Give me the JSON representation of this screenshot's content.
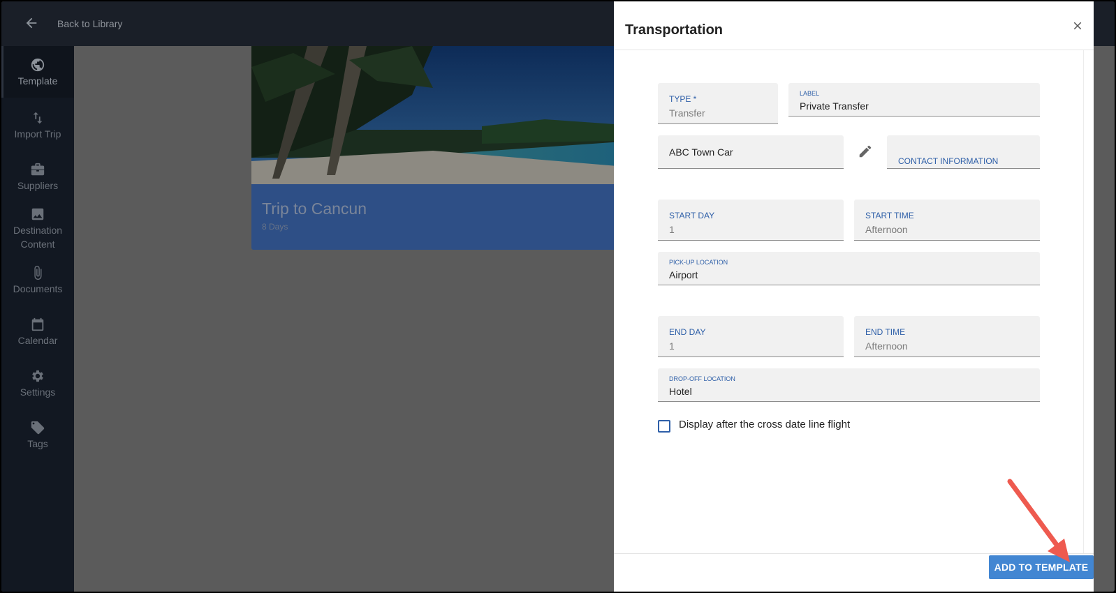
{
  "topbar": {
    "back_label": "Back to Library"
  },
  "sidebar": {
    "items": [
      {
        "label": "Template",
        "icon": "globe-icon"
      },
      {
        "label": "Import Trip",
        "icon": "swap-vertical-icon"
      },
      {
        "label": "Suppliers",
        "icon": "briefcase-icon"
      },
      {
        "label": "Destination Content",
        "icon": "image-icon"
      },
      {
        "label": "Documents",
        "icon": "paperclip-icon"
      },
      {
        "label": "Calendar",
        "icon": "calendar-icon"
      },
      {
        "label": "Settings",
        "icon": "gear-icon"
      },
      {
        "label": "Tags",
        "icon": "tag-icon"
      }
    ]
  },
  "card": {
    "title": "Trip to Cancun",
    "subtitle": "8 Days"
  },
  "panel": {
    "title": "Transportation",
    "type": {
      "label": "TYPE *",
      "value": "Transfer"
    },
    "label_field": {
      "label": "LABEL",
      "value": "Private Transfer"
    },
    "supplier": {
      "value": "ABC Town Car"
    },
    "contact": {
      "label": "CONTACT INFORMATION"
    },
    "start_day": {
      "label": "START DAY",
      "value": "1"
    },
    "start_time": {
      "label": "START TIME",
      "value": "Afternoon"
    },
    "pickup": {
      "label": "PICK-UP LOCATION",
      "value": "Airport"
    },
    "end_day": {
      "label": "END DAY",
      "value": "1"
    },
    "end_time": {
      "label": "END TIME",
      "value": "Afternoon"
    },
    "dropoff": {
      "label": "DROP-OFF LOCATION",
      "value": "Hotel"
    },
    "checkbox_label": "Display after the cross date line flight",
    "add_button": "ADD TO TEMPLATE"
  },
  "colors": {
    "accent": "#2e5fa8",
    "button": "#4286d2",
    "annotation_arrow": "#ee5a4f"
  }
}
